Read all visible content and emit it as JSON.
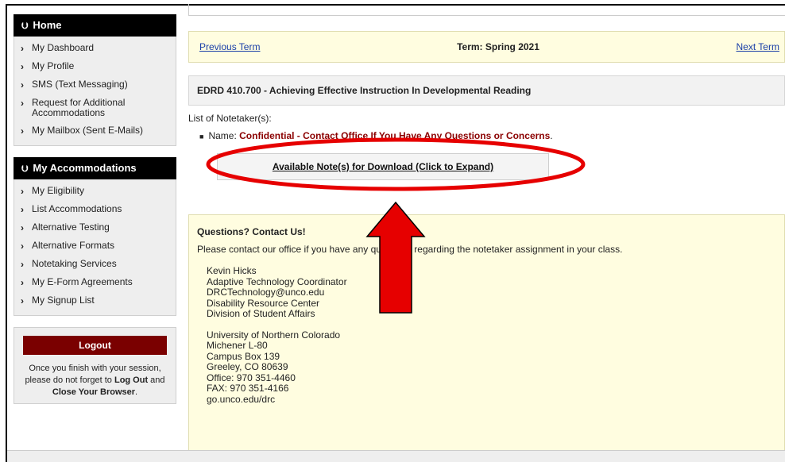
{
  "sidebar": {
    "home_header": "Home",
    "home_items": [
      {
        "label": "My Dashboard"
      },
      {
        "label": "My Profile"
      },
      {
        "label": "SMS (Text Messaging)"
      },
      {
        "label": "Request for Additional Accommodations"
      },
      {
        "label": "My Mailbox (Sent E-Mails)"
      }
    ],
    "accom_header": "My Accommodations",
    "accom_items": [
      {
        "label": "My Eligibility"
      },
      {
        "label": "List Accommodations"
      },
      {
        "label": "Alternative Testing"
      },
      {
        "label": "Alternative Formats"
      },
      {
        "label": "Notetaking Services"
      },
      {
        "label": "My E-Form Agreements"
      },
      {
        "label": "My Signup List"
      }
    ],
    "logout_label": "Logout",
    "logout_text_1": "Once you finish with your session, please do not forget to ",
    "logout_text_bold1": "Log Out",
    "logout_text_2": " and ",
    "logout_text_bold2": "Close Your Browser",
    "logout_text_3": "."
  },
  "term": {
    "previous": "Previous Term",
    "title": "Term: Spring 2021",
    "next": "Next Term"
  },
  "course": {
    "title": "EDRD 410.700 - Achieving Effective Instruction In Developmental Reading"
  },
  "notetakers": {
    "label": "List of Notetaker(s):",
    "name_prefix": "Name: ",
    "name_value": "Confidential - Contact Office If You Have Any Questions or Concerns",
    "name_suffix": "."
  },
  "download": {
    "label": "Available Note(s) for Download (Click to Expand)"
  },
  "contact": {
    "heading": "Questions? Contact Us!",
    "intro": "Please contact our office if you have any questions regarding the notetaker assignment in your class.",
    "lines_1": [
      "Kevin Hicks",
      "Adaptive Technology Coordinator",
      "DRCTechnology@unco.edu",
      "Disability Resource Center",
      "Division of Student Affairs"
    ],
    "lines_2": [
      "University of Northern Colorado",
      "Michener L-80",
      "Campus Box 139",
      "Greeley, CO 80639",
      "Office: 970 351-4460",
      "FAX: 970 351-4166",
      "go.unco.edu/drc"
    ]
  },
  "colors": {
    "accent_red": "#e60000",
    "logout_bg": "#7a0000",
    "term_bg": "#fffde0"
  },
  "icons": {
    "section_toggle": "double-chevron-down-icon",
    "item_arrow": "chevron-right-icon"
  }
}
